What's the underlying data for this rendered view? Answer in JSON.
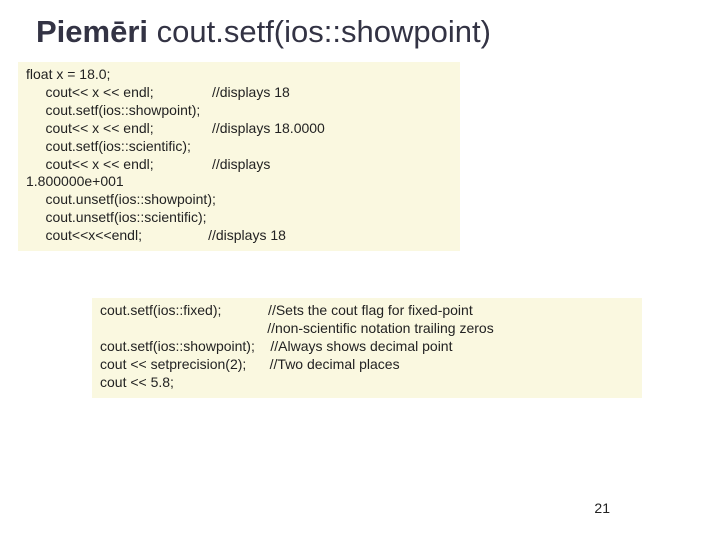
{
  "title_bold": "Piemēri",
  "title_rest": " cout.setf(ios::showpoint)",
  "code1": "float x = 18.0;\n     cout<< x << endl;               //displays 18\n     cout.setf(ios::showpoint);\n     cout<< x << endl;               //displays 18.0000\n     cout.setf(ios::scientific);\n     cout<< x << endl;               //displays\n1.800000e+001\n     cout.unsetf(ios::showpoint);\n     cout.unsetf(ios::scientific);\n     cout<<x<<endl;                 //displays 18",
  "code2": "cout.setf(ios::fixed);            //Sets the cout flag for fixed-point\n                                           //non-scientific notation trailing zeros\ncout.setf(ios::showpoint);    //Always shows decimal point\ncout << setprecision(2);      //Two decimal places\ncout << 5.8;",
  "pagenum": "21"
}
